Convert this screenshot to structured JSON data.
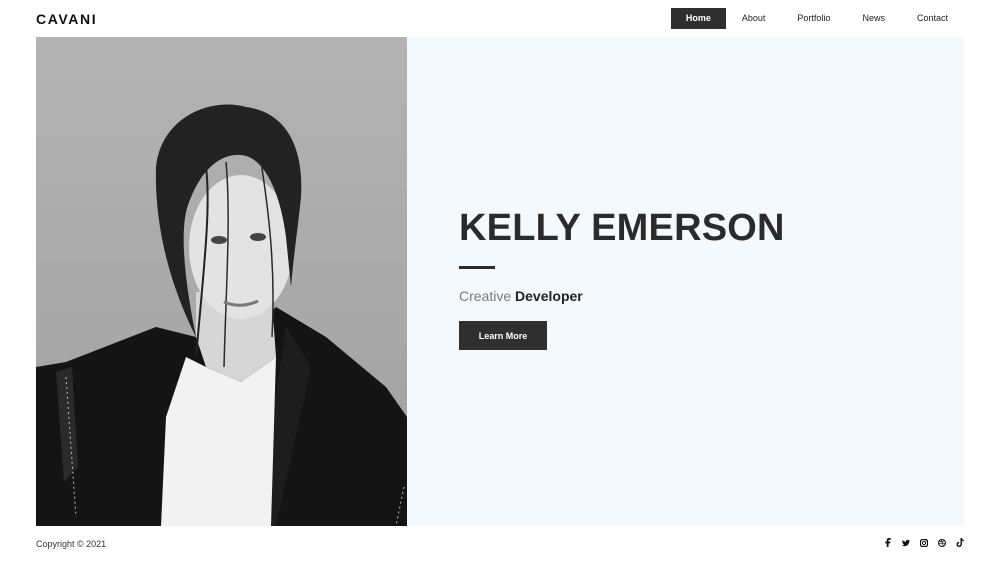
{
  "brand": {
    "logo": "CAVANI"
  },
  "nav": {
    "items": [
      {
        "label": "Home",
        "active": true
      },
      {
        "label": "About"
      },
      {
        "label": "Portfolio"
      },
      {
        "label": "News"
      },
      {
        "label": "Contact"
      }
    ]
  },
  "hero": {
    "name": "KELLY EMERSON",
    "subtitle_light": "Creative",
    "subtitle_bold": "Developer",
    "button_label": "Learn More",
    "photo": "portrait-photo"
  },
  "footer": {
    "copyright": "Copyright © 2021",
    "social": [
      "facebook-icon",
      "twitter-icon",
      "instagram-icon",
      "dribbble-icon",
      "tiktok-icon"
    ]
  },
  "colors": {
    "dark": "#2f2f2f",
    "hero_bg": "#f4f9fe",
    "text": "#1e1e1e"
  }
}
